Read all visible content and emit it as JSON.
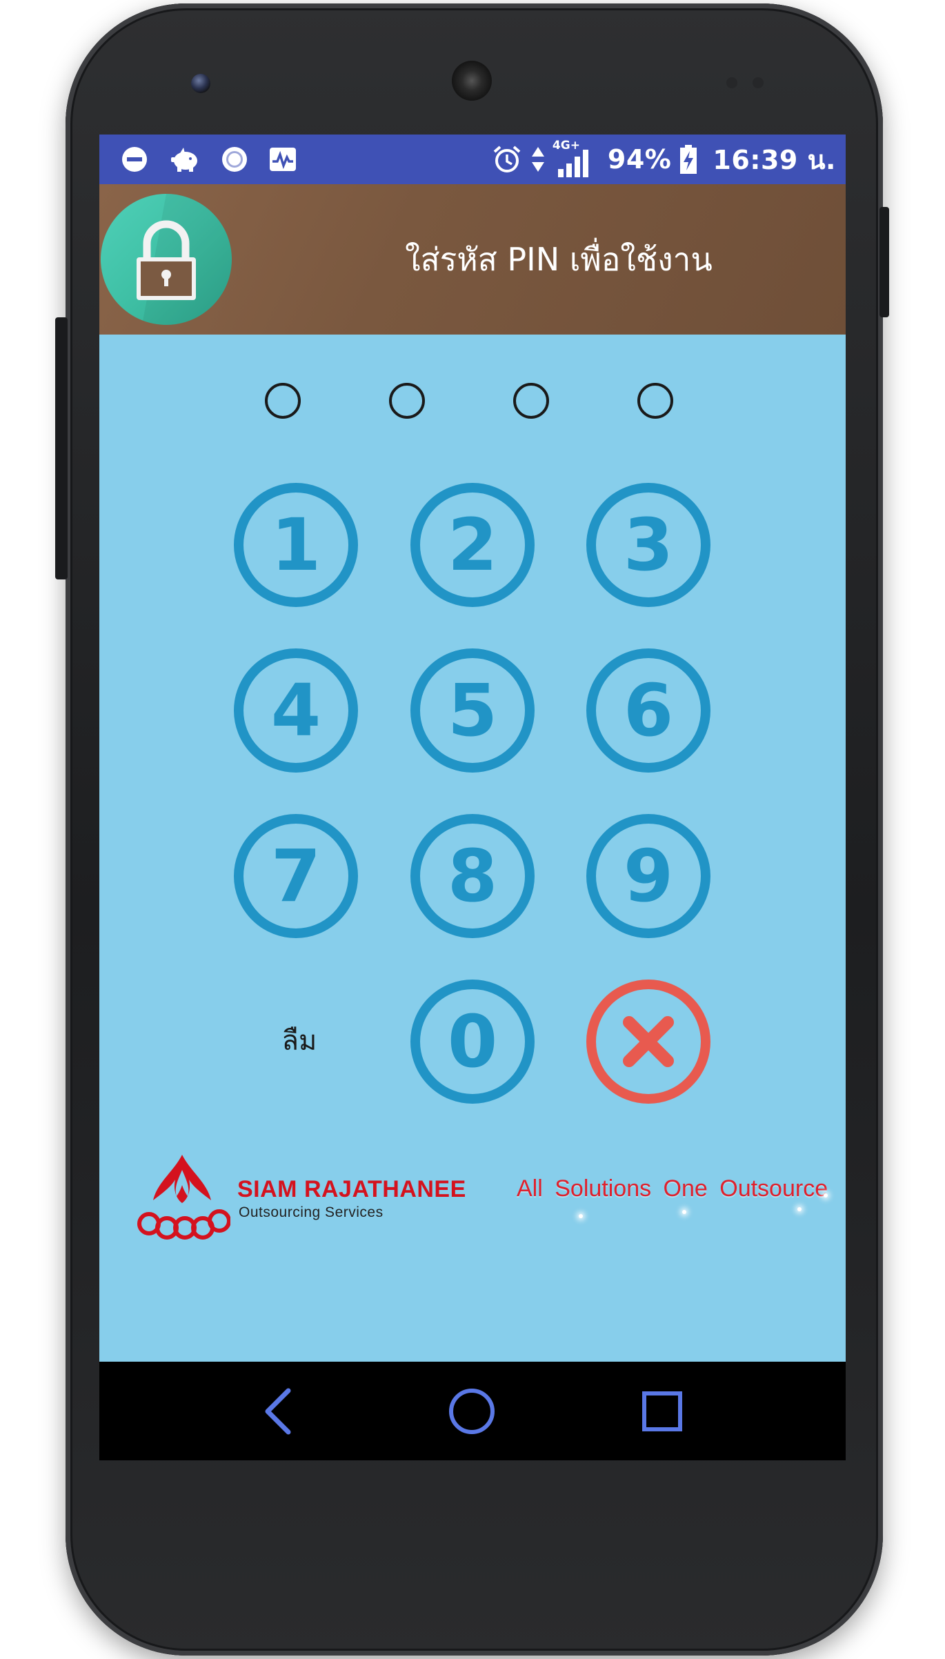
{
  "status_bar": {
    "left_icons": [
      "do-not-disturb-icon",
      "piggy-bank-icon",
      "record-icon",
      "activity-pulse-icon"
    ],
    "right_icons": [
      "alarm-icon",
      "data-arrows-icon",
      "signal-bars-icon",
      "battery-charging-icon"
    ],
    "network": "4G+",
    "battery": "94%",
    "time": "16:39 น."
  },
  "header": {
    "icon": "padlock-icon",
    "title": "ใส่รหัส PIN เพื่อใช้งาน"
  },
  "pin": {
    "length": 4,
    "entered": 0
  },
  "keypad": {
    "keys": [
      "1",
      "2",
      "3",
      "4",
      "5",
      "6",
      "7",
      "8",
      "9",
      "0"
    ],
    "forgot_label": "ลืม",
    "delete_icon": "close-x-icon"
  },
  "branding": {
    "logo_icon": "flame-rings-logo",
    "name": "SIAM RAJATHANEE",
    "subtitle": "Outsourcing Services",
    "tagline": "All Solutions One Outsource"
  },
  "colors": {
    "status_bar": "#3f51b5",
    "header": "#7a583f",
    "background": "#87ceeb",
    "key": "#2194c6",
    "delete": "#e85a4f",
    "brand": "#d4121e",
    "nav_icons": "#5a78e6"
  },
  "navigation": {
    "icons": [
      "back-icon",
      "home-icon",
      "recents-icon"
    ]
  }
}
